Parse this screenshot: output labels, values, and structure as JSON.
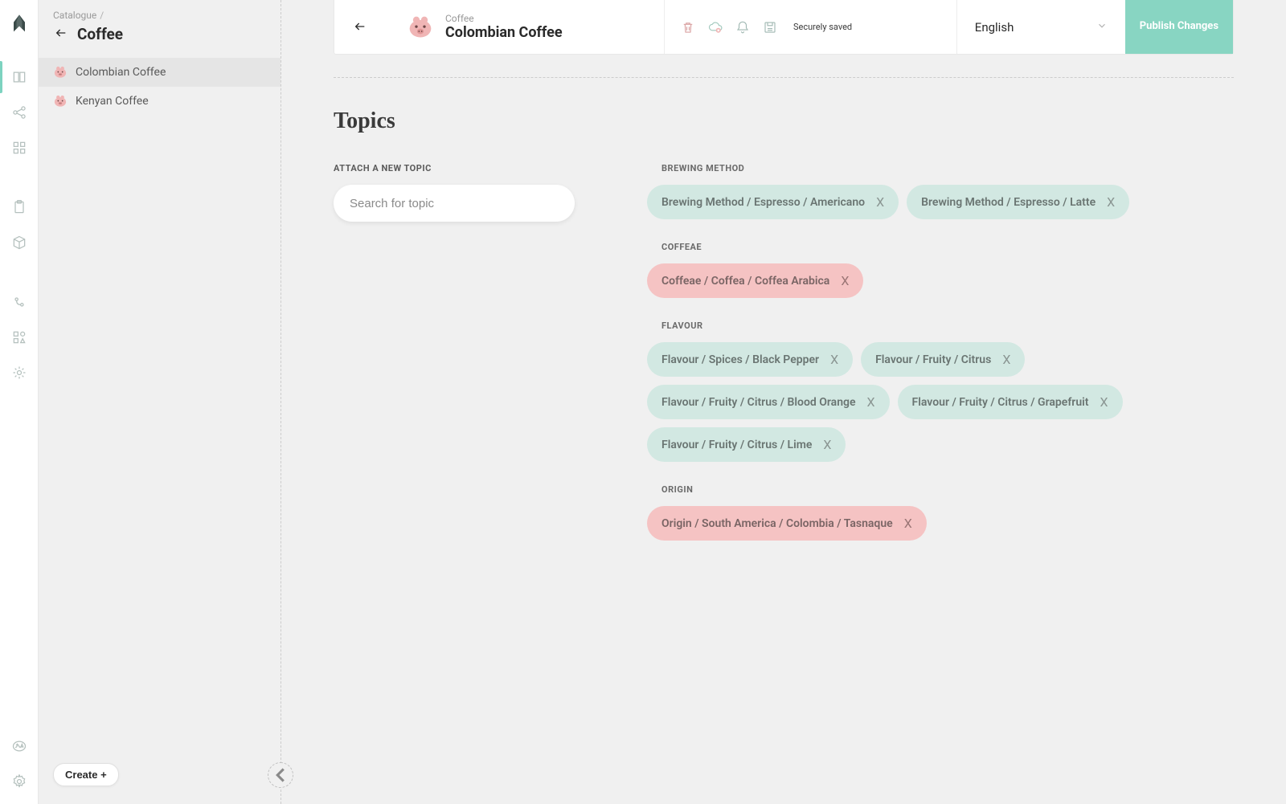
{
  "sidebar": {
    "breadcrumb": "Catalogue",
    "title": "Coffee",
    "items": [
      {
        "label": "Colombian Coffee",
        "active": true
      },
      {
        "label": "Kenyan Coffee",
        "active": false
      }
    ],
    "create_label": "Create +"
  },
  "header": {
    "breadcrumb": "Coffee",
    "title": "Colombian Coffee",
    "saved_text": "Securely saved",
    "language": "English",
    "publish_label": "Publish Changes"
  },
  "topics": {
    "heading": "Topics",
    "attach_label": "ATTACH A NEW TOPIC",
    "search_placeholder": "Search for topic",
    "groups": [
      {
        "label": "BREWING METHOD",
        "chips": [
          {
            "text": "Brewing Method / Espresso / Americano",
            "color": "green"
          },
          {
            "text": "Brewing Method / Espresso / Latte",
            "color": "green"
          }
        ]
      },
      {
        "label": "COFFEAE",
        "chips": [
          {
            "text": "Coffeae / Coffea / Coffea Arabica",
            "color": "pink"
          }
        ]
      },
      {
        "label": "FLAVOUR",
        "chips": [
          {
            "text": "Flavour / Spices / Black Pepper",
            "color": "green"
          },
          {
            "text": "Flavour / Fruity / Citrus",
            "color": "green"
          },
          {
            "text": "Flavour / Fruity / Citrus / Blood Orange",
            "color": "green"
          },
          {
            "text": "Flavour / Fruity / Citrus / Grapefruit",
            "color": "green"
          },
          {
            "text": "Flavour / Fruity / Citrus / Lime",
            "color": "green"
          }
        ]
      },
      {
        "label": "ORIGIN",
        "chips": [
          {
            "text": "Origin / South America / Colombia / Tasnaque",
            "color": "pink"
          }
        ]
      }
    ]
  }
}
